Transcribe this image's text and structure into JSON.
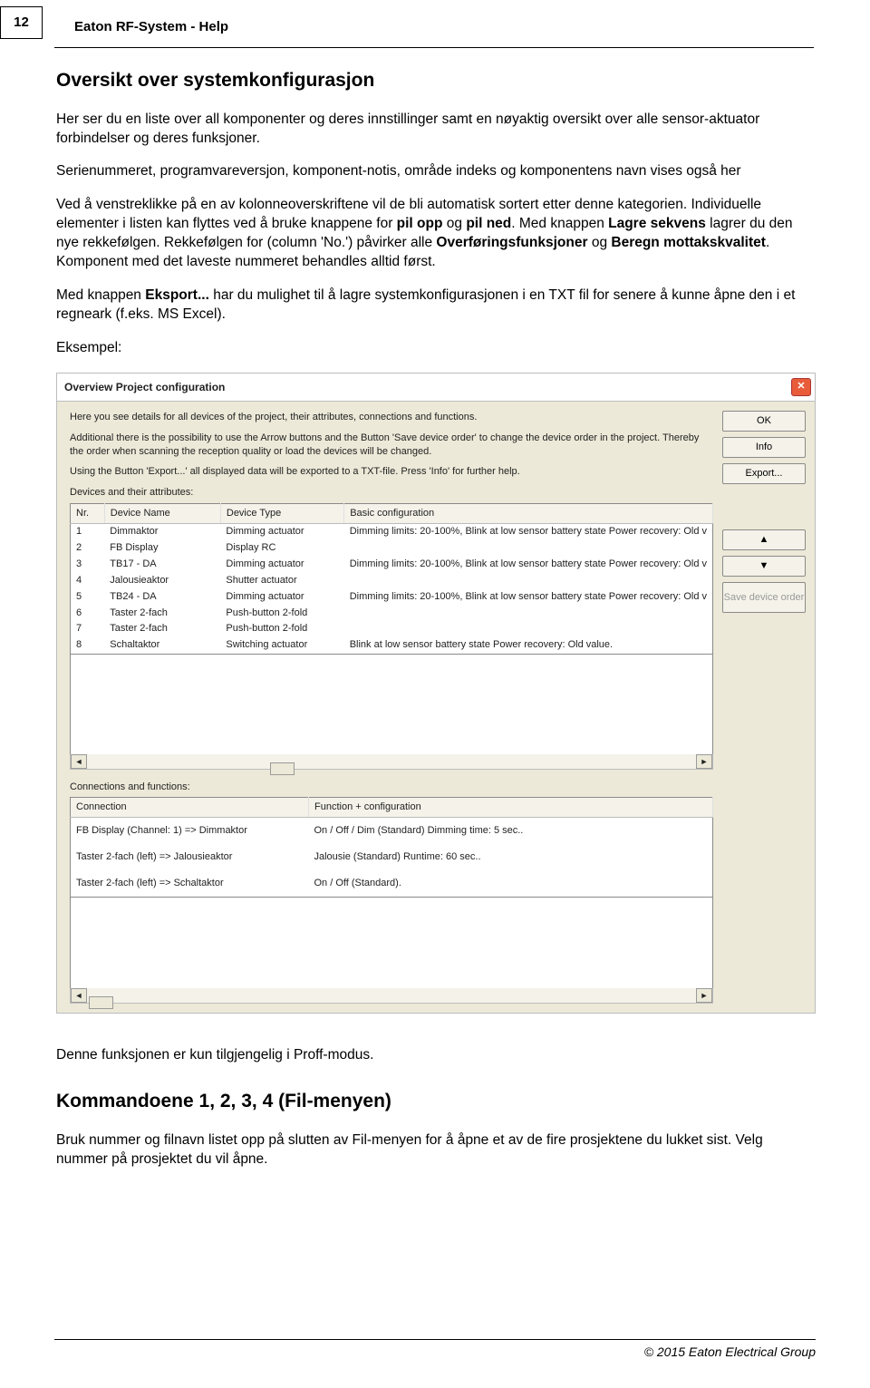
{
  "page_number": "12",
  "doc_title": "Eaton RF-System - Help",
  "h_overview": "Oversikt over systemkonfigurasjon",
  "p1": "Her ser du en liste over all komponenter og deres innstillinger samt en nøyaktig oversikt over alle sensor-aktuator forbindelser og deres funksjoner.",
  "p2": "Serienummeret, programvareversjon, komponent-notis, område indeks og komponentens navn vises også her",
  "p3_a": "Ved å venstreklikke på en av kolonneoverskriftene vil de bli automatisk sortert etter denne kategorien. Individuelle elementer i listen kan flyttes ved å bruke knappene for ",
  "p3_b": "pil opp",
  "p3_c": " og ",
  "p3_d": "pil ned",
  "p3_e": ". Med  knappen ",
  "p3_f": "Lagre sekvens",
  "p3_g": " lagrer du den nye rekkefølgen. Rekkefølgen for (column 'No.') påvirker alle ",
  "p3_h": "Overføringsfunksjoner",
  "p3_i": " og ",
  "p3_j": "Beregn mottakskvalitet",
  "p3_k": ". Komponent med det laveste nummeret behandles alltid først.",
  "p4_a": "Med knappen ",
  "p4_b": "Eksport...",
  "p4_c": " har du mulighet til å lagre systemkonfigurasjonen i en TXT fil for senere å kunne åpne den i et regneark (f.eks. MS Excel).",
  "p5": "Eksempel:",
  "dlg": {
    "title": "Overview Project configuration",
    "desc1": "Here you see details for all devices of the project, their attributes, connections and functions.",
    "desc2": "Additional there is the possibility to use the Arrow buttons and the Button 'Save device order' to change the device order in the project. Thereby the order when scanning the reception quality or load the devices will be changed.",
    "desc3": "Using the Button 'Export...' all displayed data will be exported to a TXT-file. Press 'Info' for further help.",
    "devices_label": "Devices and their attributes:",
    "btn_ok": "OK",
    "btn_info": "Info",
    "btn_export": "Export...",
    "btn_up": "▲",
    "btn_down": "▼",
    "btn_save": "Save device order",
    "devices_headers": {
      "nr": "Nr.",
      "name": "Device Name",
      "type": "Device Type",
      "basic": "Basic configuration"
    },
    "devices": [
      {
        "nr": "1",
        "name": "Dimmaktor",
        "type": "Dimming actuator",
        "basic": "Dimming limits: 20-100%, Blink at low sensor battery state Power recovery: Old v"
      },
      {
        "nr": "2",
        "name": "FB Display",
        "type": "Display RC",
        "basic": ""
      },
      {
        "nr": "3",
        "name": "TB17 - DA",
        "type": "Dimming actuator",
        "basic": "Dimming limits: 20-100%, Blink at low sensor battery state Power recovery: Old v"
      },
      {
        "nr": "4",
        "name": "Jalousieaktor",
        "type": "Shutter actuator",
        "basic": ""
      },
      {
        "nr": "5",
        "name": "TB24 - DA",
        "type": "Dimming actuator",
        "basic": "Dimming limits: 20-100%, Blink at low sensor battery state Power recovery: Old v"
      },
      {
        "nr": "6",
        "name": "Taster 2-fach",
        "type": "Push-button 2-fold",
        "basic": ""
      },
      {
        "nr": "7",
        "name": "Taster 2-fach",
        "type": "Push-button 2-fold",
        "basic": ""
      },
      {
        "nr": "8",
        "name": "Schaltaktor",
        "type": "Switching actuator",
        "basic": "Blink at low sensor battery state Power recovery: Old value."
      }
    ],
    "conn_label": "Connections and functions:",
    "conn_headers": {
      "c": "Connection",
      "f": "Function + configuration"
    },
    "connections": [
      {
        "c": "FB Display (Channel: 1) => Dimmaktor",
        "f": "On / Off / Dim (Standard) Dimming time: 5 sec.."
      },
      {
        "c": "Taster 2-fach (left) => Jalousieaktor",
        "f": "Jalousie (Standard) Runtime: 60 sec.."
      },
      {
        "c": "Taster 2-fach (left) => Schaltaktor",
        "f": "On / Off (Standard)."
      }
    ]
  },
  "p_after": "Denne funksjonen er kun tilgjengelig i Proff-modus.",
  "h_kommando": "Kommandoene 1, 2, 3, 4 (Fil-menyen)",
  "p_kommando": "Bruk nummer og filnavn listet opp på slutten av Fil-menyen for å åpne et av de fire prosjektene du lukket sist. Velg nummer på prosjektet du vil åpne.",
  "copyright": "© 2015 Eaton Electrical Group"
}
